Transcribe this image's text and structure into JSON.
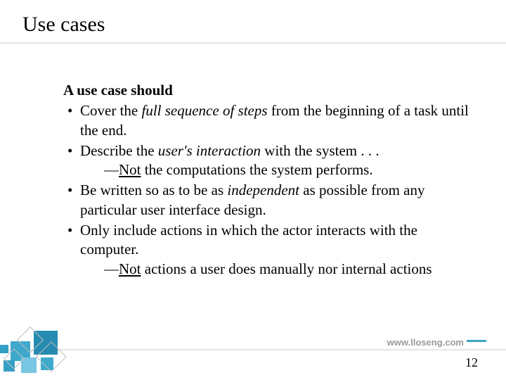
{
  "title": "Use cases",
  "heading": "A use case should",
  "bullets": [
    {
      "pre": "Cover the ",
      "emph": "full sequence of steps",
      "post": " from the beginning of a task until the end.",
      "sub_pre": "",
      "sub_u": "",
      "sub_post": ""
    },
    {
      "pre": "Describe the ",
      "emph": "user's interaction",
      "post": " with the system . . .",
      "sub_pre": "",
      "sub_u": "Not",
      "sub_post": " the computations the system performs."
    },
    {
      "pre": "Be written so as to be as ",
      "emph": "independent",
      "post": " as possible from any particular user interface design.",
      "sub_pre": "",
      "sub_u": "",
      "sub_post": ""
    },
    {
      "pre": "Only include actions in which the actor interacts with the computer.",
      "emph": "",
      "post": "",
      "sub_pre": "",
      "sub_u": "Not",
      "sub_post": " actions a user does manually nor internal actions"
    }
  ],
  "footer_url": "www.lloseng.com",
  "page_number": "12"
}
